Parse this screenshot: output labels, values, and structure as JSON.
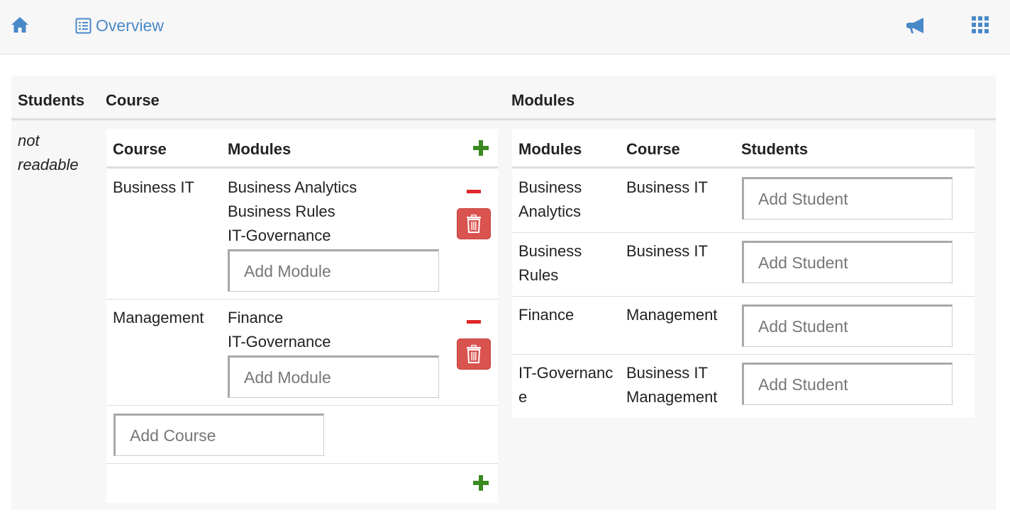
{
  "nav": {
    "home_icon": "home-icon",
    "overview_icon": "list-alt-icon",
    "overview_label": "Overview",
    "announce_icon": "bullhorn-icon",
    "apps_icon": "grid-icon",
    "link_color": "#4a89c8"
  },
  "headers": {
    "students": "Students",
    "course": "Course",
    "modules": "Modules"
  },
  "students_value": "not readable",
  "courses_table": {
    "col_course": "Course",
    "col_modules": "Modules",
    "rows": [
      {
        "course": "Business IT",
        "modules": [
          "Business Analytics",
          "Business Rules",
          "IT-Governance"
        ],
        "add_module_placeholder": "Add Module"
      },
      {
        "course": "Management",
        "modules": [
          "Finance",
          "IT-Governance"
        ],
        "add_module_placeholder": "Add Module"
      }
    ],
    "add_course_placeholder": "Add Course"
  },
  "modules_table": {
    "col_modules": "Modules",
    "col_course": "Course",
    "col_students": "Students",
    "rows": [
      {
        "module": "Business Analytics",
        "courses": [
          "Business IT"
        ],
        "add_student_placeholder": "Add Student"
      },
      {
        "module": "Business Rules",
        "courses": [
          "Business IT"
        ],
        "add_student_placeholder": "Add Student"
      },
      {
        "module": "Finance",
        "courses": [
          "Management"
        ],
        "add_student_placeholder": "Add Student"
      },
      {
        "module": "IT-Governance",
        "courses": [
          "Business IT",
          "Management"
        ],
        "add_student_placeholder": "Add Student"
      }
    ]
  },
  "colors": {
    "add_green": "#3a8a22",
    "remove_red": "#e0262a",
    "delete_red": "#d9534f"
  }
}
